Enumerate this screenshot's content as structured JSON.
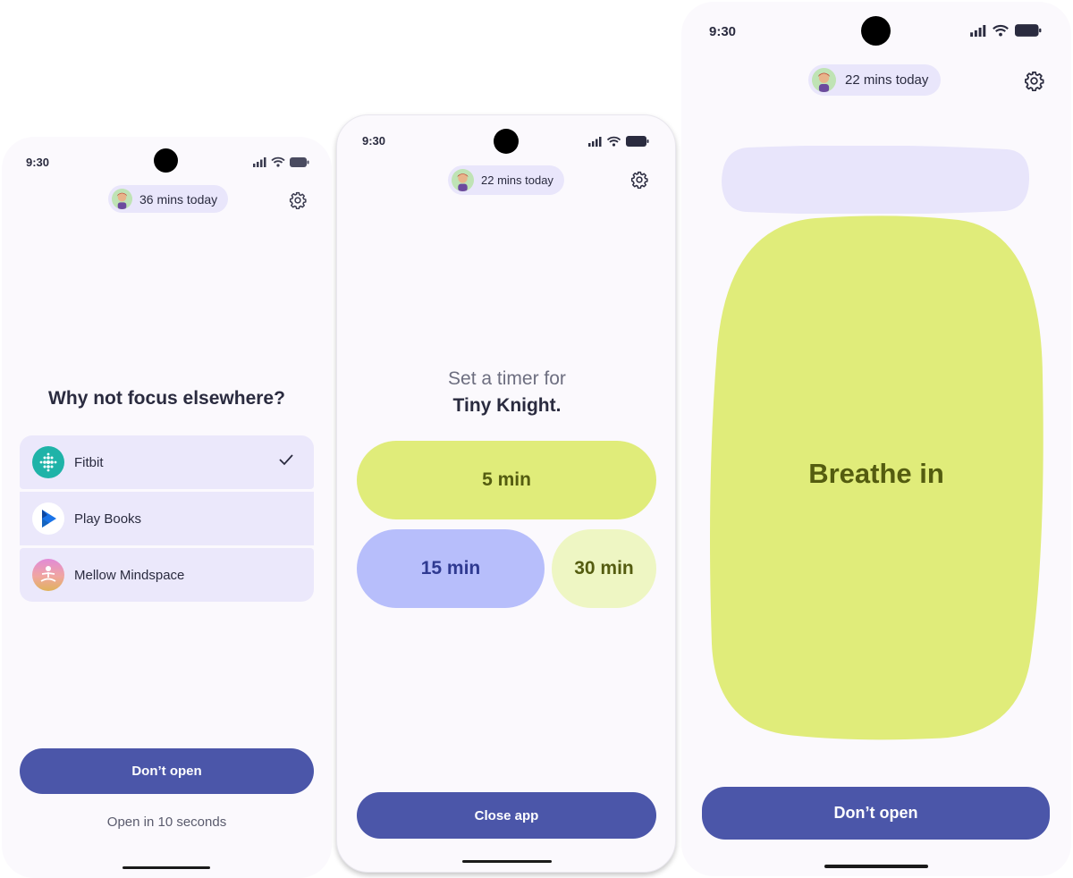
{
  "screens": [
    {
      "status": {
        "time": "9:30"
      },
      "header": {
        "usage": "36 mins today"
      },
      "title": "Why not focus elsewhere?",
      "apps": [
        {
          "label": "Fitbit",
          "icon": "fitbit-icon",
          "selected": true
        },
        {
          "label": "Play Books",
          "icon": "play-books-icon",
          "selected": false
        },
        {
          "label": "Mellow Mindspace",
          "icon": "meditation-icon",
          "selected": false
        }
      ],
      "primary_button": "Don’t open",
      "secondary_text": "Open in 10 seconds"
    },
    {
      "status": {
        "time": "9:30"
      },
      "header": {
        "usage": "22 mins today"
      },
      "prompt": "Set a timer for",
      "app_name": "Tiny Knight.",
      "timers": [
        "5 min",
        "15 min",
        "30 min"
      ],
      "primary_button": "Close app"
    },
    {
      "status": {
        "time": "9:30"
      },
      "header": {
        "usage": "22 mins today"
      },
      "breathe_text": "Breathe in",
      "primary_button": "Don’t open"
    }
  ],
  "colors": {
    "primary": "#4b56a9",
    "lime": "#e0ec7a",
    "lavender": "#e9e6fb",
    "periwinkle": "#b7befb",
    "pale_lime": "#eef6c3",
    "olive_text": "#545c10"
  }
}
